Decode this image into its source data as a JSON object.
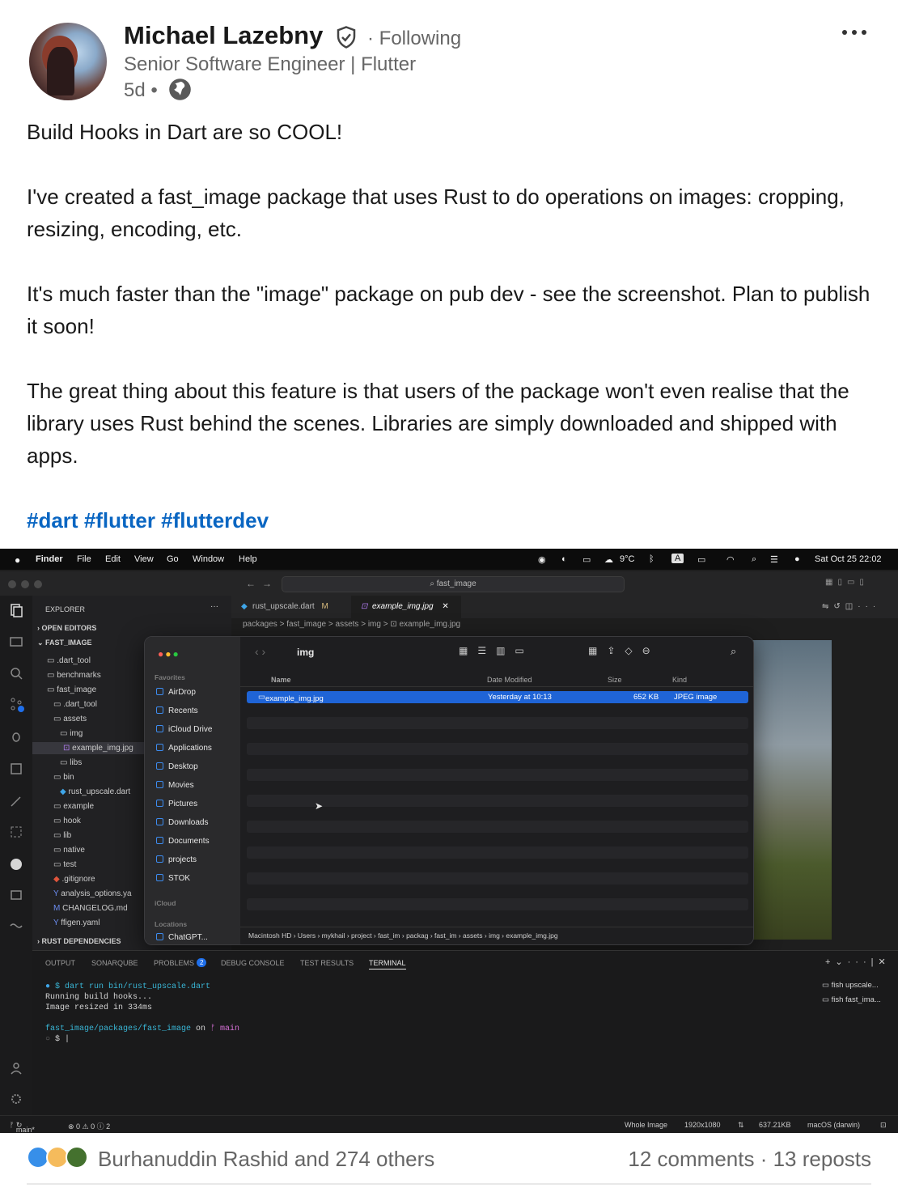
{
  "author": {
    "name": "Michael Lazebny",
    "follow_status": "· Following",
    "headline": "Senior Software Engineer | Flutter",
    "time": "5d •"
  },
  "post": {
    "paragraphs": [
      "Build Hooks in Dart are so COOL!",
      "I've created a fast_image package that uses Rust to do operations on images: cropping, resizing, encoding, etc.",
      "It's much faster than the \"image\" package on pub dev - see the screenshot. Plan to publish it soon!",
      "The great thing about this feature is that users of the package won't even realise that the library uses Rust behind the scenes. Libraries are simply downloaded and shipped with apps."
    ],
    "hashtags": [
      "#dart",
      "#flutter",
      "#flutterdev"
    ]
  },
  "screenshot": {
    "menubar": {
      "app": "Finder",
      "items": [
        "File",
        "Edit",
        "View",
        "Go",
        "Window",
        "Help"
      ],
      "weather": "9°C",
      "input_badge": "A",
      "datetime": "Sat Oct 25  22:02"
    },
    "search_label": "fast_image",
    "explorer": {
      "title": "EXPLORER",
      "open_editors": "OPEN EDITORS",
      "root": "FAST_IMAGE",
      "tree": [
        ".dart_tool",
        "benchmarks",
        "fast_image",
        ".dart_tool",
        "assets",
        "img",
        "example_img.jpg",
        "libs",
        "bin",
        "rust_upscale.dart",
        "example",
        "hook",
        "lib",
        "native",
        "test",
        ".gitignore",
        "analysis_options.ya",
        "CHANGELOG.md",
        "ffigen.yaml"
      ],
      "rust_deps": "RUST DEPENDENCIES"
    },
    "tabs": [
      {
        "label": "rust_upscale.dart",
        "badge": "M"
      },
      {
        "label": "example_img.jpg"
      }
    ],
    "breadcrumb": "packages > fast_image > assets > img > ⊡ example_img.jpg",
    "finder": {
      "folder": "img",
      "favorites_label": "Favorites",
      "favorites": [
        "AirDrop",
        "Recents",
        "iCloud Drive",
        "Applications",
        "Desktop",
        "Movies",
        "Pictures",
        "Downloads",
        "Documents",
        "projects",
        "STOK"
      ],
      "icloud_label": "iCloud",
      "locations_label": "Locations",
      "location_item": "ChatGPT...",
      "columns": {
        "name": "Name",
        "date": "Date Modified",
        "size": "Size",
        "kind": "Kind"
      },
      "file": {
        "name": "example_img.jpg",
        "date": "Yesterday at 10:13",
        "size": "652 KB",
        "kind": "JPEG image"
      },
      "path": "Macintosh HD › Users › mykhail › project › fast_im › packag › fast_im › assets › img › example_img.jpg"
    },
    "panel": {
      "tabs": [
        "OUTPUT",
        "SONARQUBE",
        "PROBLEMS",
        "DEBUG CONSOLE",
        "TEST RESULTS",
        "TERMINAL"
      ],
      "problems_count": "2",
      "terminal": {
        "cmd": "$ dart run bin/rust_upscale.dart",
        "line1": "Running build hooks...",
        "line2": "Image resized in 334ms",
        "cwd": "fast_image/packages/fast_image",
        "on": " on ",
        "branch": "ᚠ main",
        "prompt": "$ |"
      },
      "sessions": [
        "fish  upscale...",
        "fish  fast_ima..."
      ]
    },
    "statusbar": {
      "branch": "main*",
      "problems": "⊗ 0 ⚠ 0 ⓘ 2",
      "image_mode": "Whole Image",
      "dimensions": "1920x1080",
      "filesize": "637.21KB",
      "os": "macOS (darwin)"
    }
  },
  "social": {
    "reactors": "Burhanuddin Rashid and 274 others",
    "comments": "12 comments",
    "separator": " · ",
    "reposts": "13 reposts"
  },
  "colors": {
    "link": "#0a66c2",
    "muted": "#666666",
    "finder_selection": "#1f64d6"
  }
}
